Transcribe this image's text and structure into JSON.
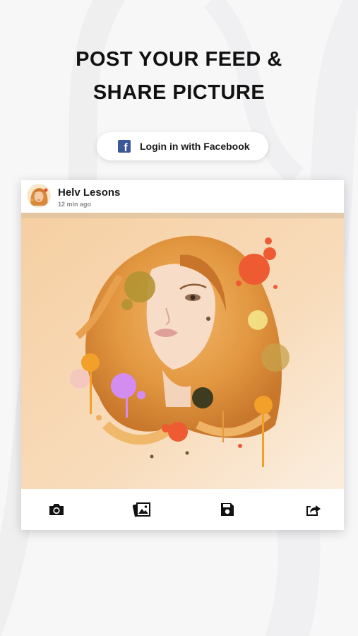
{
  "headline": {
    "line1": "POST YOUR FEED &",
    "line2": "SHARE PICTURE"
  },
  "facebook_login": {
    "label": "Login in with Facebook",
    "icon": "facebook-icon",
    "brand_color": "#3b5998"
  },
  "post": {
    "author": "Helv Lesons",
    "time": "12 min ago",
    "image": "watercolor-portrait-woman"
  },
  "toolbar": [
    {
      "icon": "camera-icon"
    },
    {
      "icon": "gallery-icon"
    },
    {
      "icon": "save-icon"
    },
    {
      "icon": "share-icon"
    }
  ]
}
